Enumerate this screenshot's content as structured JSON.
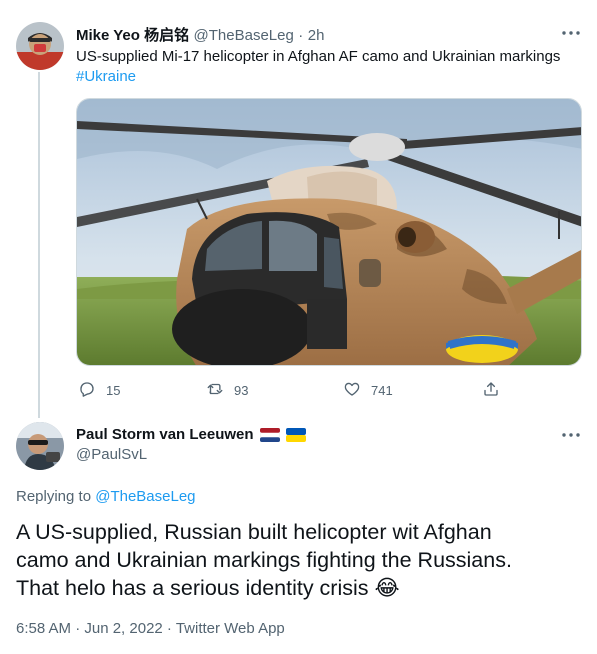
{
  "tweet1": {
    "author_name": "Mike Yeo 杨启铭",
    "handle": "@TheBaseLeg",
    "separator": "·",
    "time": "2h",
    "text": "US-supplied Mi-17 helicopter in Afghan AF camo and Ukrainian markings",
    "hashtag": "#Ukraine",
    "stats": {
      "replies": "15",
      "retweets": "93",
      "likes": "741"
    }
  },
  "tweet2": {
    "author_name": "Paul Storm van Leeuwen",
    "handle": "@PaulSvL",
    "replying_prefix": "Replying to",
    "replying_handle": "@TheBaseLeg",
    "text_lines": [
      "A US-supplied, Russian built helicopter wit Afghan",
      "camo and Ukrainian markings fighting the Russians.",
      "That helo has a serious identity crisis 😂"
    ],
    "timestamp": "6:58 AM · Jun 2, 2022 · Twitter Web App"
  },
  "icons": {
    "reply": "reply-icon",
    "retweet": "retweet-icon",
    "like": "heart-icon",
    "share": "share-icon",
    "more": "more-icon",
    "flag_nl": "netherlands-flag-icon",
    "flag_ua": "ukraine-flag-icon"
  },
  "colors": {
    "accent": "#1d9bf0",
    "muted": "#536471",
    "text": "#0f1419",
    "divider": "#cfd9de"
  }
}
